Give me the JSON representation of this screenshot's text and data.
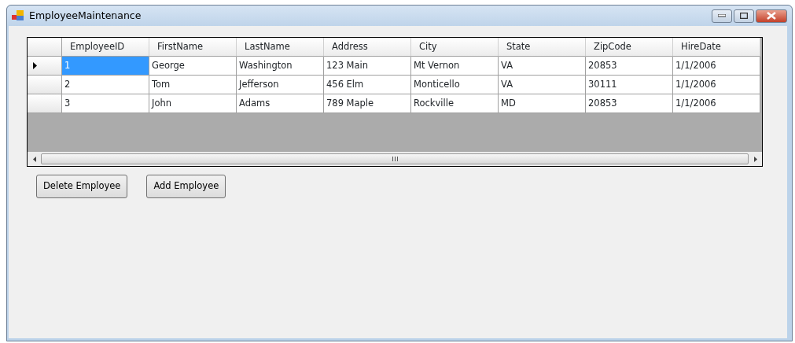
{
  "window": {
    "title": "EmployeeMaintenance"
  },
  "table": {
    "columns": [
      "EmployeeID",
      "FirstName",
      "LastName",
      "Address",
      "City",
      "State",
      "ZipCode",
      "HireDate"
    ],
    "rows": [
      {
        "selected": true,
        "cells": [
          "1",
          "George",
          "Washington",
          "123 Main",
          "Mt Vernon",
          "VA",
          "20853",
          "1/1/2006"
        ]
      },
      {
        "selected": false,
        "cells": [
          "2",
          "Tom",
          "Jefferson",
          "456 Elm",
          "Monticello",
          "VA",
          "30111",
          "1/1/2006"
        ]
      },
      {
        "selected": false,
        "cells": [
          "3",
          "John",
          "Adams",
          "789 Maple",
          "Rockville",
          "MD",
          "20853",
          "1/1/2006"
        ]
      }
    ]
  },
  "buttons": [
    "Delete Employee",
    "Add Employee"
  ]
}
